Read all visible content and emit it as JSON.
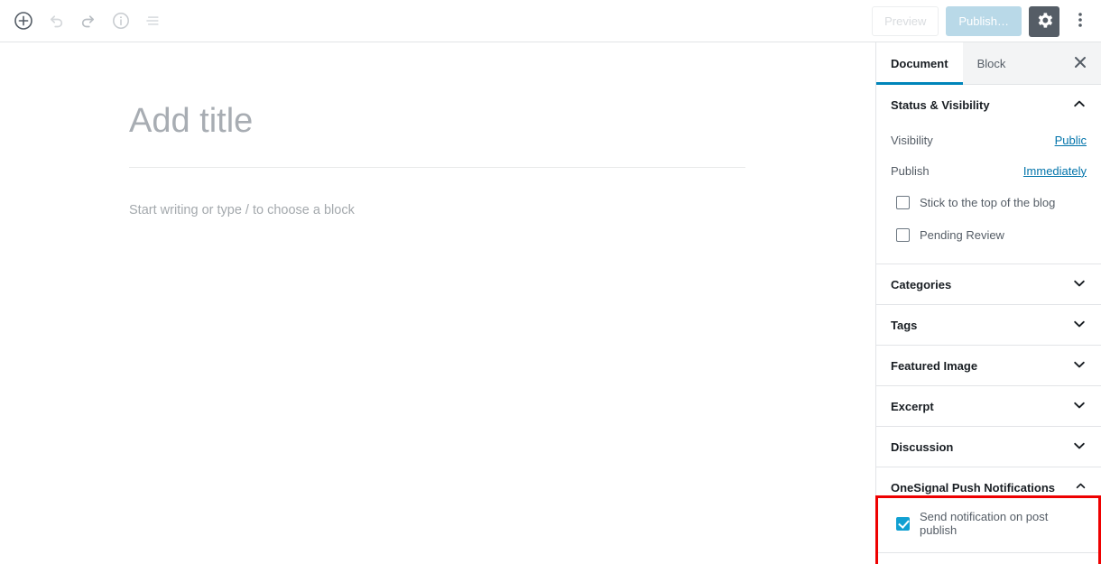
{
  "toolbar": {
    "left_buttons": [
      {
        "name": "add-block-icon",
        "label": "Add block"
      },
      {
        "name": "undo-icon",
        "label": "Undo"
      },
      {
        "name": "redo-icon",
        "label": "Redo"
      },
      {
        "name": "info-icon",
        "label": "Content structure"
      },
      {
        "name": "block-navigation-icon",
        "label": "Block navigation"
      }
    ],
    "preview_label": "Preview",
    "publish_label": "Publish…",
    "settings_label": "Settings",
    "more_label": "More tools & options"
  },
  "editor": {
    "title_placeholder": "Add title",
    "body_placeholder": "Start writing or type / to choose a block"
  },
  "sidebar": {
    "tabs": [
      {
        "label": "Document",
        "active": true
      },
      {
        "label": "Block",
        "active": false
      }
    ],
    "close_label": "Close settings",
    "panels": [
      {
        "title": "Status & Visibility",
        "expanded": true,
        "rows": [
          {
            "label": "Visibility",
            "value": "Public"
          },
          {
            "label": "Publish",
            "value": "Immediately"
          }
        ],
        "checkboxes": [
          {
            "label": "Stick to the top of the blog",
            "checked": false
          },
          {
            "label": "Pending Review",
            "checked": false
          }
        ]
      },
      {
        "title": "Categories",
        "expanded": false
      },
      {
        "title": "Tags",
        "expanded": false
      },
      {
        "title": "Featured Image",
        "expanded": false
      },
      {
        "title": "Excerpt",
        "expanded": false
      },
      {
        "title": "Discussion",
        "expanded": false
      },
      {
        "title": "OneSignal Push Notifications",
        "expanded": true,
        "checkboxes": [
          {
            "label": "Send notification on post publish",
            "checked": true
          }
        ]
      }
    ]
  },
  "colors": {
    "accent_blue": "#0085ba",
    "link_blue": "#0073aa",
    "checkbox_blue": "#11a0d2",
    "publish_disabled": "#b9d9e8",
    "gear_bg": "#555d66",
    "highlight_red": "#ee0000",
    "border": "#e2e4e7"
  }
}
